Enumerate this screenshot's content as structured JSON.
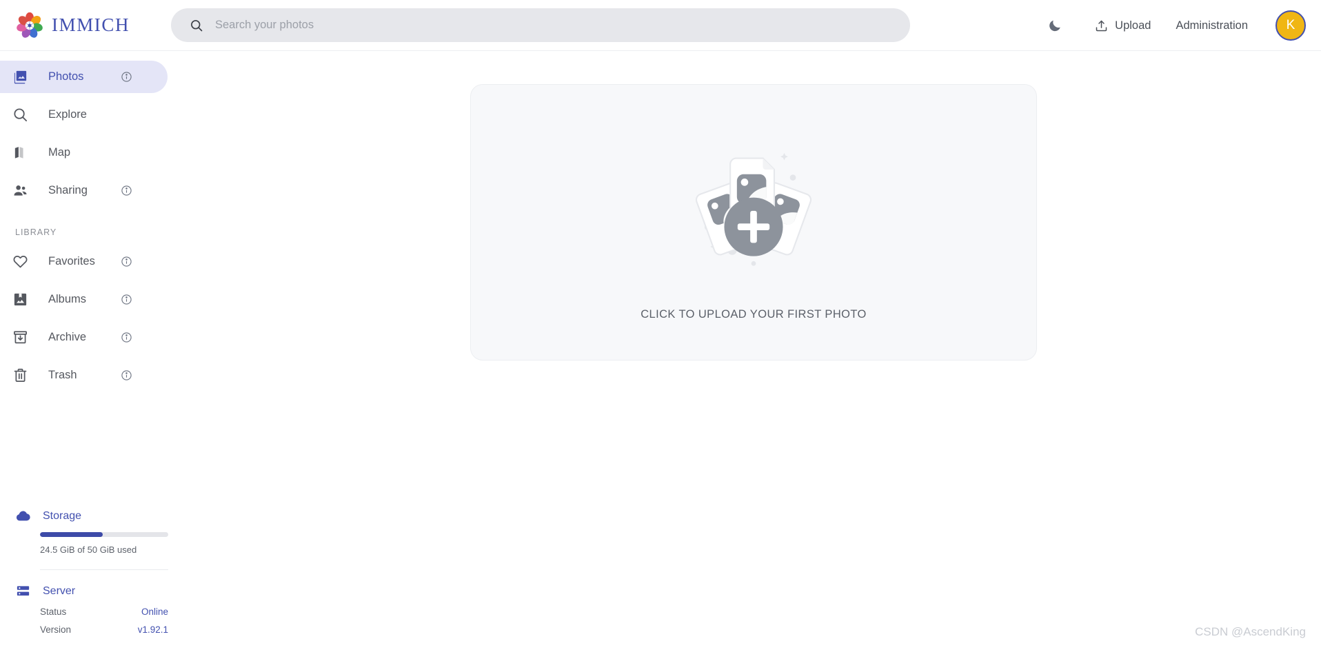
{
  "app": {
    "brand_name": "IMMICH",
    "logo_icon": "immich-flower-logo"
  },
  "search": {
    "placeholder": "Search your photos",
    "value": "",
    "icon": "search-icon"
  },
  "header": {
    "theme_toggle_icon": "moon-icon",
    "upload_label": "Upload",
    "upload_icon": "upload-icon",
    "administration_label": "Administration",
    "avatar_initial": "K",
    "avatar_bg": "#f0b614",
    "avatar_border": "#4250af"
  },
  "sidebar": {
    "primary_items": [
      {
        "label": "Photos",
        "icon": "photos-icon",
        "active": true,
        "has_info": true
      },
      {
        "label": "Explore",
        "icon": "search-icon",
        "active": false,
        "has_info": false
      },
      {
        "label": "Map",
        "icon": "map-icon",
        "active": false,
        "has_info": false
      },
      {
        "label": "Sharing",
        "icon": "sharing-icon",
        "active": false,
        "has_info": true
      }
    ],
    "library_label": "LIBRARY",
    "library_items": [
      {
        "label": "Favorites",
        "icon": "heart-icon",
        "has_info": true
      },
      {
        "label": "Albums",
        "icon": "albums-icon",
        "has_info": true
      },
      {
        "label": "Archive",
        "icon": "archive-icon",
        "has_info": true
      },
      {
        "label": "Trash",
        "icon": "trash-icon",
        "has_info": true
      }
    ],
    "storage": {
      "title": "Storage",
      "icon": "cloud-icon",
      "usage_text": "24.5 GiB of 50 GiB used",
      "used_percent": 49
    },
    "server": {
      "title": "Server",
      "icon": "server-icon",
      "status_label": "Status",
      "status_value": "Online",
      "version_label": "Version",
      "version_value": "v1.92.1"
    }
  },
  "main": {
    "upload_caption": "CLICK TO UPLOAD YOUR FIRST PHOTO",
    "illustration_icon": "photo-cards-plus-illustration"
  },
  "watermark": {
    "text": "CSDN @AscendKing"
  },
  "colors": {
    "accent": "#4250af",
    "accent_active_bg": "#e4e5f7",
    "progress_fill": "#3d4ba8",
    "panel_bg": "#f7f8fa",
    "search_bg": "#e6e7eb"
  }
}
